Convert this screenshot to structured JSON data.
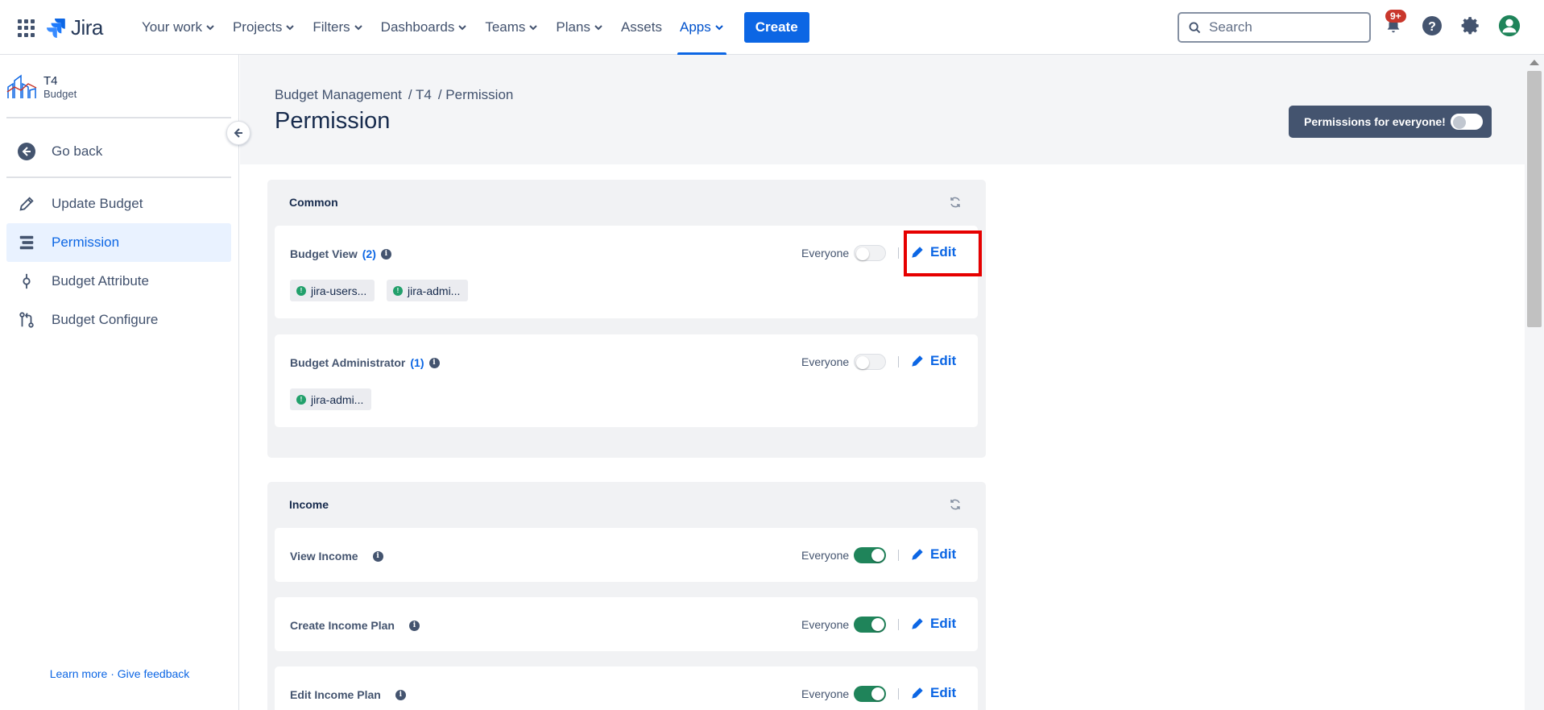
{
  "topnav": {
    "logo_text": "Jira",
    "items": [
      {
        "label": "Your work",
        "has_chevron": true
      },
      {
        "label": "Projects",
        "has_chevron": true
      },
      {
        "label": "Filters",
        "has_chevron": true
      },
      {
        "label": "Dashboards",
        "has_chevron": true
      },
      {
        "label": "Teams",
        "has_chevron": true
      },
      {
        "label": "Plans",
        "has_chevron": true
      },
      {
        "label": "Assets",
        "has_chevron": false
      },
      {
        "label": "Apps",
        "has_chevron": true,
        "active": true
      }
    ],
    "create_label": "Create",
    "search_placeholder": "Search",
    "notifications_badge": "9+"
  },
  "sidebar": {
    "project_name": "T4",
    "project_type": "Budget",
    "go_back": "Go back",
    "items": [
      {
        "label": "Update Budget",
        "icon": "pencil-icon"
      },
      {
        "label": "Permission",
        "icon": "permission-icon",
        "active": true
      },
      {
        "label": "Budget Attribute",
        "icon": "attribute-icon"
      },
      {
        "label": "Budget Configure",
        "icon": "configure-icon"
      }
    ],
    "footer_learn": "Learn more",
    "footer_sep": " · ",
    "footer_feedback": "Give feedback"
  },
  "header": {
    "breadcrumb": [
      "Budget Management",
      "/ T4",
      "/ Permission"
    ],
    "title": "Permission",
    "everyone_toggle_label": "Permissions for everyone!"
  },
  "labels": {
    "everyone": "Everyone",
    "edit": "Edit"
  },
  "sections": [
    {
      "title": "Common",
      "cards": [
        {
          "label": "Budget View",
          "count": "(2)",
          "everyone_on": false,
          "groups": [
            "jira-users...",
            "jira-admi..."
          ],
          "highlight": true
        },
        {
          "label": "Budget Administrator",
          "count": "(1)",
          "everyone_on": false,
          "groups": [
            "jira-admi..."
          ]
        }
      ]
    },
    {
      "title": "Income",
      "cards": [
        {
          "label": "View Income",
          "count": "",
          "everyone_on": true,
          "groups": []
        },
        {
          "label": "Create Income Plan",
          "count": "",
          "everyone_on": true,
          "groups": []
        },
        {
          "label": "Edit Income Plan",
          "count": "",
          "everyone_on": true,
          "groups": []
        }
      ]
    }
  ],
  "colors": {
    "accent": "#0c66e4",
    "toggle_on": "#1f845a",
    "highlight": "#e60000"
  }
}
